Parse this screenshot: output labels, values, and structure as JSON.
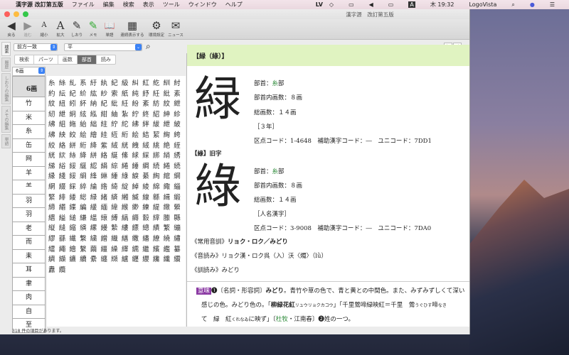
{
  "menubar": {
    "app": "漢字源 改訂第五版",
    "items": [
      "ファイル",
      "編集",
      "検索",
      "表示",
      "ツール",
      "ウィンドウ",
      "ヘルプ"
    ],
    "status": {
      "lv": "LV",
      "input": "A",
      "clock": "木 19:32",
      "user": "LogoVista"
    }
  },
  "window": {
    "title": "漢字源　改訂第五版"
  },
  "toolbar": [
    {
      "label": "戻る",
      "icon": "◀"
    },
    {
      "label": "進む",
      "icon": "▶"
    },
    {
      "label": "縮小",
      "icon": "A"
    },
    {
      "label": "拡大",
      "icon": "A"
    },
    {
      "label": "しおり",
      "icon": "✎"
    },
    {
      "label": "メモ",
      "icon": "✎"
    },
    {
      "label": "単語",
      "icon": "📖"
    },
    {
      "label": "連続表示する",
      "icon": "▦"
    },
    {
      "label": "環境設定",
      "icon": "⚙"
    },
    {
      "label": "ニュース",
      "icon": "✉"
    }
  ],
  "search": {
    "mode": "前方一致",
    "value": "平"
  },
  "tabs": [
    "検索",
    "パーツ",
    "画数",
    "部首",
    "読み"
  ],
  "active_tab": "部首",
  "vtabs": [
    "検索",
    "履歴",
    "しおりの編集",
    "メモの編集",
    "単語"
  ],
  "stroke_select": "6画",
  "radicals": [
    "6画",
    "竹",
    "米",
    "糸",
    "缶",
    "网",
    "羊",
    "⺷",
    "羽",
    "羽",
    "老",
    "而",
    "耒",
    "耳",
    "聿",
    "肉",
    "自",
    "至"
  ],
  "kanji_list": "糸絲糺系紆紈紀級糾紅紇紃紂約紜紀紒紘紗索紙純紓紝紕素紋紐紖紑納紀紕紝紛紊紡紋紲紉紲絅絃紭紺紬紮紵終紹紳紾紼組絁紿絀紸紵紽紼絆紱紲紴紼紻絞絵繪絓絚絎絵結絜絢絝絞絡絣絎絳紫絨絖絏絨絩絶絰絖絘絲絳絣絡綖絛絿綵綁綃綉綈綌綏綖綛絹綜綣綞綢続綣続縁綫綏綗綘綝綞綠綟綦綯綰綱網綴綵綷綸綹綺綻綽綾綿緅緇緊緋緌総緑緒緕緗緘線緜緝緞締緡緤編緩緬緯緱緲練緹緻縈縉縊縋縑縕縗縛縞縟縠縡縢縣縦縫縮縯縲縵縶縷縹總績繁繃繆繇繊繋繍繒織繕繖繙繚繞繡繧繩繪繫繭繮繰繹繻繼繽繿纂纃纈纊續纍纏纐纑纒纓纔纖纘纛纜",
  "status": "318 件の項目があります。",
  "entry": {
    "header": "【緑（綠）】",
    "kanji1": "緑",
    "info1": {
      "radical_label": "部首：",
      "radical": "糸",
      "radical_suffix": "部",
      "inner": "部首内画数：８画",
      "total": "総画数：１４画",
      "grade": "［３年］",
      "codes": "区点コード：1-4648　補助漢字コード：―　ユニコード：7DD1"
    },
    "old_label": "【綠】旧字",
    "kanji2": "綠",
    "info2": {
      "radical_label": "部首：",
      "radical": "糸",
      "radical_suffix": "部",
      "inner": "部首内画数：８画",
      "total": "総画数：１４画",
      "grade": "［人名漢字］",
      "codes": "区点コード：3-9008　補助漢字コード：―　ユニコード：7DA0"
    },
    "joyo_label": "《常用音訓》",
    "joyo": "リョク・ロク／みどり",
    "on_label": "《音読み》",
    "on": "リョク漢・ロク呉（入）沃〈燭〉（lǜ）",
    "kun_label": "《訓読み》",
    "kun": "みどり",
    "imi_badge": "意味",
    "imi1a": "❶〔名詞・形容詞〕",
    "imi1b": "みどり",
    "imi1c": "。青竹や草の色で、青と黄との中間色。また、みずみずしくて深い",
    "imi2a": "感じの色。みどり色の。「",
    "imi2b": "柳緑花紅",
    "imi2c": "リュウリョクカコウ",
    "imi2d": "」「千里鶯啼緑映紅＝千里　鶯",
    "imi2e": "うぐひす",
    "imi2f": "啼",
    "imi2g": "なき",
    "imi3a": "て　緑　紅",
    "imi3b": "くれなゐ",
    "imi3c": "に映ず」〔",
    "imi3d": "杜牧",
    "imi3e": "・江南春〕❷姓の一つ。"
  },
  "colors": {
    "header_bg": "#e0f3c1",
    "accent_green": "#2e8b3a",
    "imi_badge": "#8b3aa3",
    "tab_active": "#6b6b6b"
  }
}
